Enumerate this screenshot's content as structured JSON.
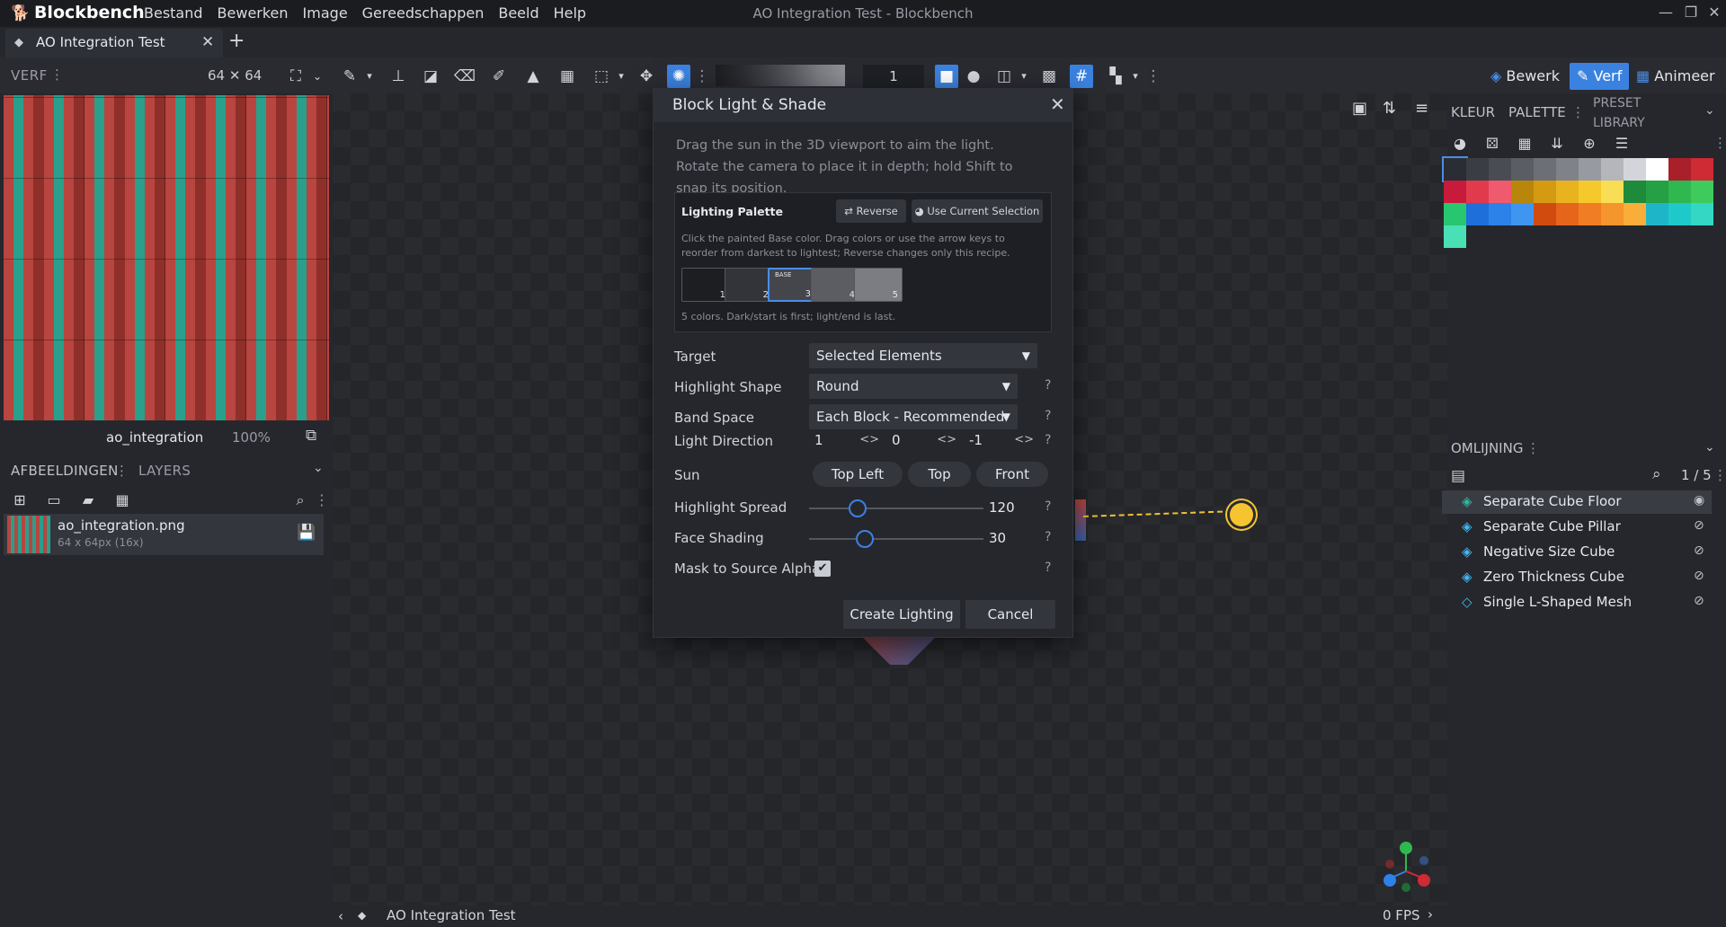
{
  "app": {
    "name": "Blockbench",
    "window_title": "AO Integration Test - Blockbench"
  },
  "menu": [
    "Bestand",
    "Bewerken",
    "Image",
    "Gereedschappen",
    "Beeld",
    "Help"
  ],
  "tab": {
    "label": "AO Integration Test"
  },
  "toolbar": {
    "panel_title": "VERF",
    "size": "64 ✕ 64",
    "brush_size": "1"
  },
  "modes": {
    "edit": "Bewerk",
    "paint": "Verf",
    "animate": "Animeer"
  },
  "left": {
    "texture_name": "ao_integration",
    "zoom": "100%",
    "tabs": {
      "images": "AFBEELDINGEN",
      "layers": "LAYERS"
    },
    "texture_item": {
      "name": "ao_integration.png",
      "sub": "64 x 64px (16x)"
    }
  },
  "right": {
    "tabs": {
      "color": "KLEUR",
      "palette": "PALETTE",
      "preset": "PRESET LIBRARY"
    },
    "outliner_title": "OMLIJNING",
    "outliner_count": "1 / 5",
    "outliner_items": [
      {
        "label": "Separate Cube Floor"
      },
      {
        "label": "Separate Cube Pillar"
      },
      {
        "label": "Negative Size Cube"
      },
      {
        "label": "Zero Thickness Cube"
      },
      {
        "label": "Single L-Shaped Mesh"
      }
    ],
    "swatches": [
      "#2b2d34",
      "#3b3d44",
      "#4a4c53",
      "#5b5d64",
      "#6d6f76",
      "#80828a",
      "#989aa1",
      "#b4b6bc",
      "#d4d5da",
      "#ffffff",
      "#a91f2a",
      "#cf2b35",
      "#c81a3b",
      "#e03a4c",
      "#f05a6e",
      "#b8860b",
      "#d49a12",
      "#e9b320",
      "#f5c92c",
      "#f9dd55",
      "#1f8a3a",
      "#25a044",
      "#2fb84f",
      "#3fcb5c",
      "#28c76f",
      "#1e6fd9",
      "#2c82e8",
      "#3f95f0",
      "#d14b0f",
      "#e5651b",
      "#f07d24",
      "#f5952e",
      "#f9ae3a",
      "#1fb5c9",
      "#1fc9c9",
      "#34d6c4",
      "#4ae0b5"
    ]
  },
  "viewport": {
    "title": "AO Integration Test",
    "fps": "0 FPS"
  },
  "dialog": {
    "title": "Block Light & Shade",
    "description": "Drag the sun in the 3D viewport to aim the light. Rotate the camera to place it in depth; hold Shift to snap its position.",
    "palette": {
      "title": "Lighting Palette",
      "reverse": "Reverse",
      "use_selection": "Use Current Selection",
      "help": "Click the painted Base color. Drag colors or use the arrow keys to reorder from darkest to lightest; Reverse changes only this recipe.",
      "base_tag": "BASE",
      "colors": [
        {
          "n": "1",
          "hex": "#1d1e22"
        },
        {
          "n": "2",
          "hex": "#333439"
        },
        {
          "n": "3",
          "hex": "#44464c"
        },
        {
          "n": "4",
          "hex": "#5b5d63"
        },
        {
          "n": "5",
          "hex": "#7b7d83"
        }
      ],
      "count_text": "5 colors. Dark/start is first; light/end is last."
    },
    "fields": {
      "target_label": "Target",
      "target_value": "Selected Elements",
      "shape_label": "Highlight Shape",
      "shape_value": "Round",
      "band_label": "Band Space",
      "band_value": "Each Block - Recommended",
      "dir_label": "Light Direction",
      "dir_x": "1",
      "dir_y": "0",
      "dir_z": "-1",
      "sun_label": "Sun",
      "sun_topleft": "Top Left",
      "sun_top": "Top",
      "sun_front": "Front",
      "spread_label": "Highlight Spread",
      "spread_value": "120",
      "spread_fraction": 0.28,
      "face_label": "Face Shading",
      "face_value": "30",
      "face_fraction": 0.32,
      "mask_label": "Mask to Source Alpha"
    },
    "buttons": {
      "create": "Create Lighting",
      "cancel": "Cancel"
    },
    "help_mark": "?"
  }
}
